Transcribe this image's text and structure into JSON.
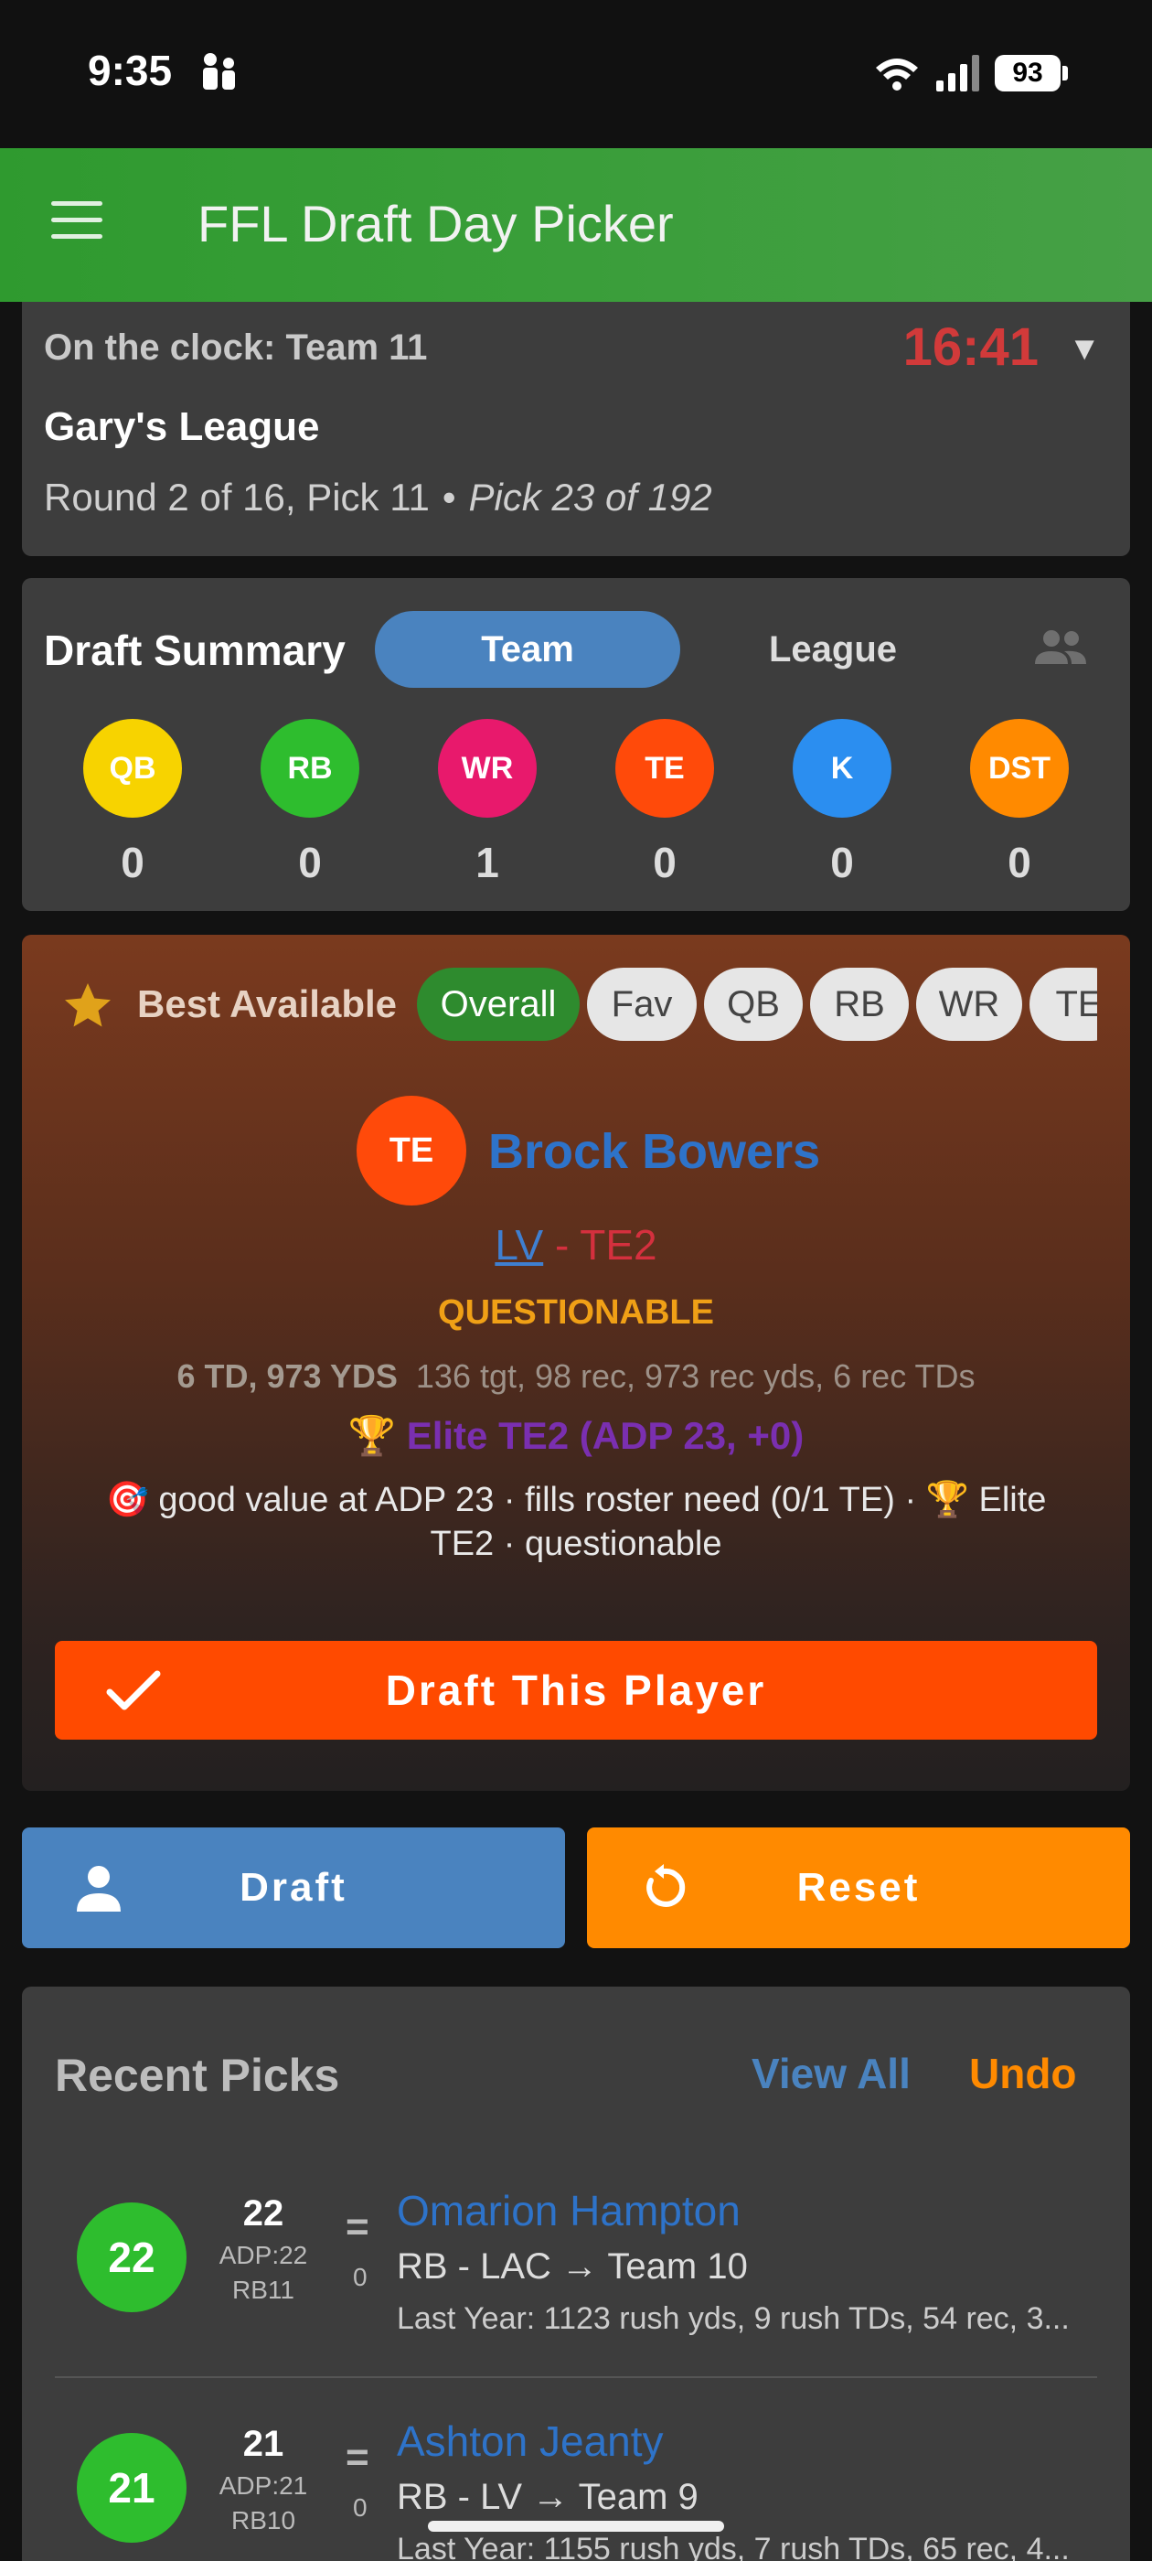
{
  "status_bar": {
    "time": "9:35",
    "battery": "93"
  },
  "app_bar": {
    "title": "FFL Draft Day Picker"
  },
  "clock": {
    "label": "On the clock: Team 11",
    "timer": "16:41",
    "league_name": "Gary's League",
    "round_text": "Round 2 of 16, Pick 11",
    "separator": "•",
    "overall_pick": "Pick 23 of 192"
  },
  "summary": {
    "title": "Draft Summary",
    "tab_team": "Team",
    "tab_league": "League",
    "positions": [
      {
        "label": "QB",
        "count": "0",
        "color": "#f7d300"
      },
      {
        "label": "RB",
        "count": "0",
        "color": "#2ebd2e"
      },
      {
        "label": "WR",
        "count": "1",
        "color": "#e8196c"
      },
      {
        "label": "TE",
        "count": "0",
        "color": "#ff4a0a"
      },
      {
        "label": "K",
        "count": "0",
        "color": "#2b8ef0"
      },
      {
        "label": "DST",
        "count": "0",
        "color": "#ff8a00"
      }
    ]
  },
  "best": {
    "title": "Best Available",
    "filters": [
      "Overall",
      "Fav",
      "QB",
      "RB",
      "WR",
      "TE"
    ],
    "player": {
      "position": "TE",
      "name": "Brock Bowers",
      "team": "LV",
      "dash": " - ",
      "pos_rank": "TE2",
      "status": "QUESTIONABLE",
      "stats_bold": "6 TD, 973 YDS",
      "stats_detail": "136 tgt, 98 rec, 973 rec yds, 6 rec TDs",
      "elite": "🏆 Elite TE2 (ADP 23, +0)",
      "reason": "🎯 good value at ADP 23 · fills roster need (0/1 TE) · 🏆 Elite TE2 · questionable"
    },
    "draft_button": "Draft This Player"
  },
  "actions": {
    "draft": "Draft",
    "reset": "Reset"
  },
  "recent": {
    "title": "Recent Picks",
    "view_all": "View All",
    "undo": "Undo",
    "picks": [
      {
        "circle": "22",
        "num": "22",
        "adp": "ADP:22",
        "rank": "RB11",
        "eq": "=",
        "diff": "0",
        "name": "Omarion Hampton",
        "team": "RB - LAC → Team 10",
        "last": "Last Year: 1123 rush yds, 9 rush TDs, 54 rec, 3..."
      },
      {
        "circle": "21",
        "num": "21",
        "adp": "ADP:21",
        "rank": "RB10",
        "eq": "=",
        "diff": "0",
        "name": "Ashton Jeanty",
        "team": "RB - LV → Team 9",
        "last": "Last Year: 1155 rush yds, 7 rush TDs, 65 rec, 4..."
      }
    ]
  }
}
